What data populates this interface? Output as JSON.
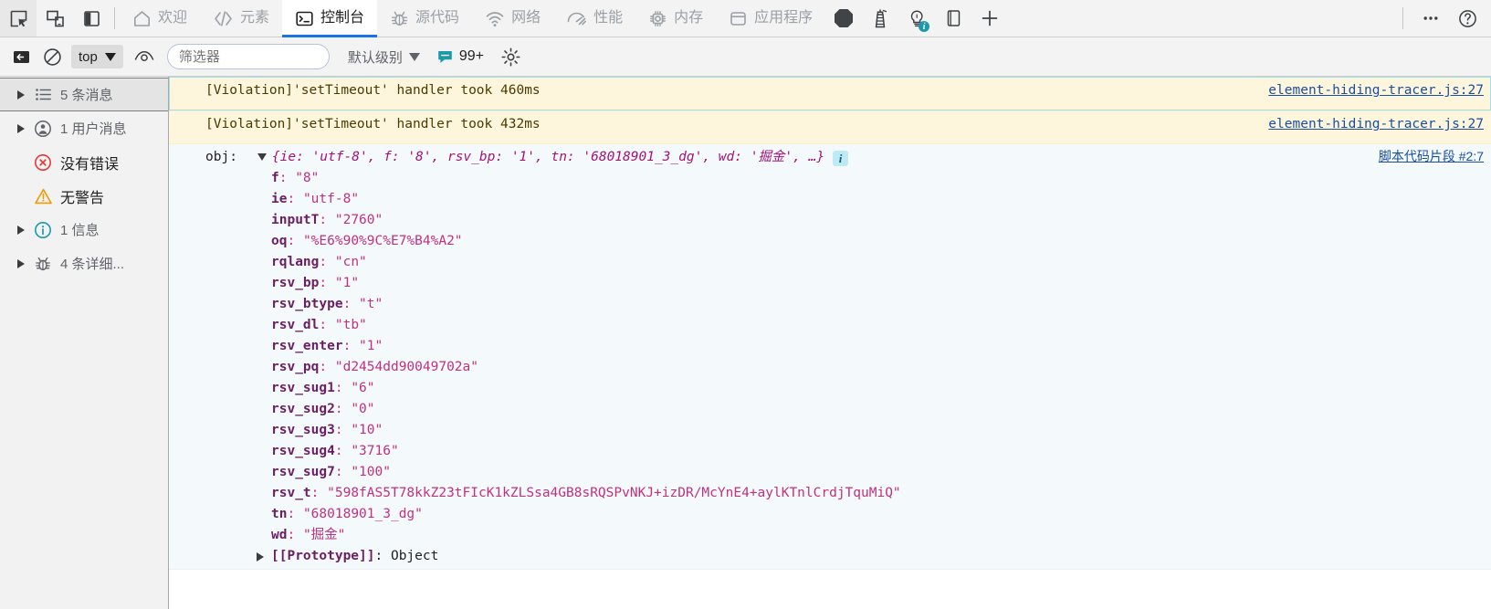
{
  "tabbar": {
    "left_tools": [
      {
        "name": "inspect-element-icon",
        "label": "检查元素"
      },
      {
        "name": "device-toolbar-icon",
        "label": "切换设备工具栏"
      },
      {
        "name": "panel-layout-icon",
        "label": "面板布局"
      }
    ],
    "tabs": [
      {
        "label": "欢迎",
        "icon": "home-icon",
        "selected": false
      },
      {
        "label": "元素",
        "icon": "code-brackets-icon",
        "selected": false
      },
      {
        "label": "控制台",
        "icon": "console-prompt-icon",
        "selected": true
      },
      {
        "label": "源代码",
        "icon": "bug-icon",
        "selected": false
      },
      {
        "label": "网络",
        "icon": "wifi-icon",
        "selected": false
      },
      {
        "label": "性能",
        "icon": "speedometer-icon",
        "selected": false
      },
      {
        "label": "内存",
        "icon": "memory-chip-icon",
        "selected": false
      },
      {
        "label": "应用程序",
        "icon": "database-icon",
        "selected": false
      }
    ],
    "extra_icons": [
      {
        "name": "recorder-octagon-icon"
      },
      {
        "name": "lighthouse-icon"
      },
      {
        "name": "lightbulb-insights-icon",
        "badge": "i"
      },
      {
        "name": "reading-panel-icon"
      }
    ],
    "add_tab_label": "+",
    "right_icons": [
      {
        "name": "more-options-icon",
        "label": "⋯"
      },
      {
        "name": "help-icon",
        "label": "?"
      }
    ]
  },
  "console_toolbar": {
    "sidebar_toggle_name": "console-sidebar-toggle-icon",
    "clear_console_name": "clear-console-icon",
    "context_selector": {
      "value": "top"
    },
    "live_expression_name": "eye-live-expression-icon",
    "filter": {
      "placeholder": "筛选器",
      "value": ""
    },
    "level_selector": {
      "value": "默认级别"
    },
    "issues": {
      "label": "99+",
      "icon": "issues-speech-icon"
    },
    "settings_name": "gear-icon"
  },
  "sidebar": {
    "items": [
      {
        "label": "5 条消息",
        "icon": "message-list-icon",
        "expandable": true,
        "selected": true,
        "tone": "grey"
      },
      {
        "label": "1 用户消息",
        "icon": "user-message-icon",
        "expandable": true,
        "selected": false,
        "tone": "grey"
      },
      {
        "label": "没有错误",
        "icon": "error-circle-icon",
        "expandable": false,
        "selected": false,
        "tone": "dark"
      },
      {
        "label": "无警告",
        "icon": "warning-triangle-icon",
        "expandable": false,
        "selected": false,
        "tone": "dark"
      },
      {
        "label": "1 信息",
        "icon": "info-circle-icon",
        "expandable": true,
        "selected": false,
        "tone": "grey"
      },
      {
        "label": "4 条详细...",
        "icon": "verbose-bug-icon",
        "expandable": true,
        "selected": false,
        "tone": "grey"
      }
    ]
  },
  "messages": [
    {
      "kind": "warning",
      "text": "[Violation]'setTimeout' handler took 460ms",
      "link": "element-hiding-tracer.js:27",
      "link_cjk": false
    },
    {
      "kind": "warning",
      "text": "[Violation]'setTimeout' handler took 432ms",
      "link": "element-hiding-tracer.js:27",
      "link_cjk": false
    }
  ],
  "object_message": {
    "kind": "info",
    "label": "obj:",
    "preview": "{ie: 'utf-8', f: '8', rsv_bp: '1', tn: '68018901_3_dg', wd: '掘金', …}",
    "info_badge": "i",
    "link": "脚本代码片段 #2:7",
    "link_cjk": true,
    "properties": [
      {
        "key": "f",
        "value": "\"8\""
      },
      {
        "key": "ie",
        "value": "\"utf-8\""
      },
      {
        "key": "inputT",
        "value": "\"2760\""
      },
      {
        "key": "oq",
        "value": "\"%E6%90%9C%E7%B4%A2\""
      },
      {
        "key": "rqlang",
        "value": "\"cn\""
      },
      {
        "key": "rsv_bp",
        "value": "\"1\""
      },
      {
        "key": "rsv_btype",
        "value": "\"t\""
      },
      {
        "key": "rsv_dl",
        "value": "\"tb\""
      },
      {
        "key": "rsv_enter",
        "value": "\"1\""
      },
      {
        "key": "rsv_pq",
        "value": "\"d2454dd90049702a\""
      },
      {
        "key": "rsv_sug1",
        "value": "\"6\""
      },
      {
        "key": "rsv_sug2",
        "value": "\"0\""
      },
      {
        "key": "rsv_sug3",
        "value": "\"10\""
      },
      {
        "key": "rsv_sug4",
        "value": "\"3716\""
      },
      {
        "key": "rsv_sug7",
        "value": "\"100\""
      },
      {
        "key": "rsv_t",
        "value": "\"598fAS5T78kkZ23tFIcK1kZLSsa4GB8sRQSPvNKJ+izDR/McYnE4+aylKTnlCrdjTquMiQ\""
      },
      {
        "key": "tn",
        "value": "\"68018901_3_dg\""
      },
      {
        "key": "wd",
        "value": "\"掘金\""
      }
    ],
    "prototype": {
      "label": "[[Prototype]]",
      "value": "Object"
    }
  },
  "colors": {
    "accent": "#1a73e8",
    "warning_bg": "#fdf6dd",
    "info_bg": "#f4f9fb",
    "link": "#1a4fa0",
    "prop_key": "#6b1f62",
    "prop_val": "#c0317f",
    "error_red": "#e53935",
    "warning_orange": "#f29900",
    "info_teal": "#1a9aaa"
  }
}
